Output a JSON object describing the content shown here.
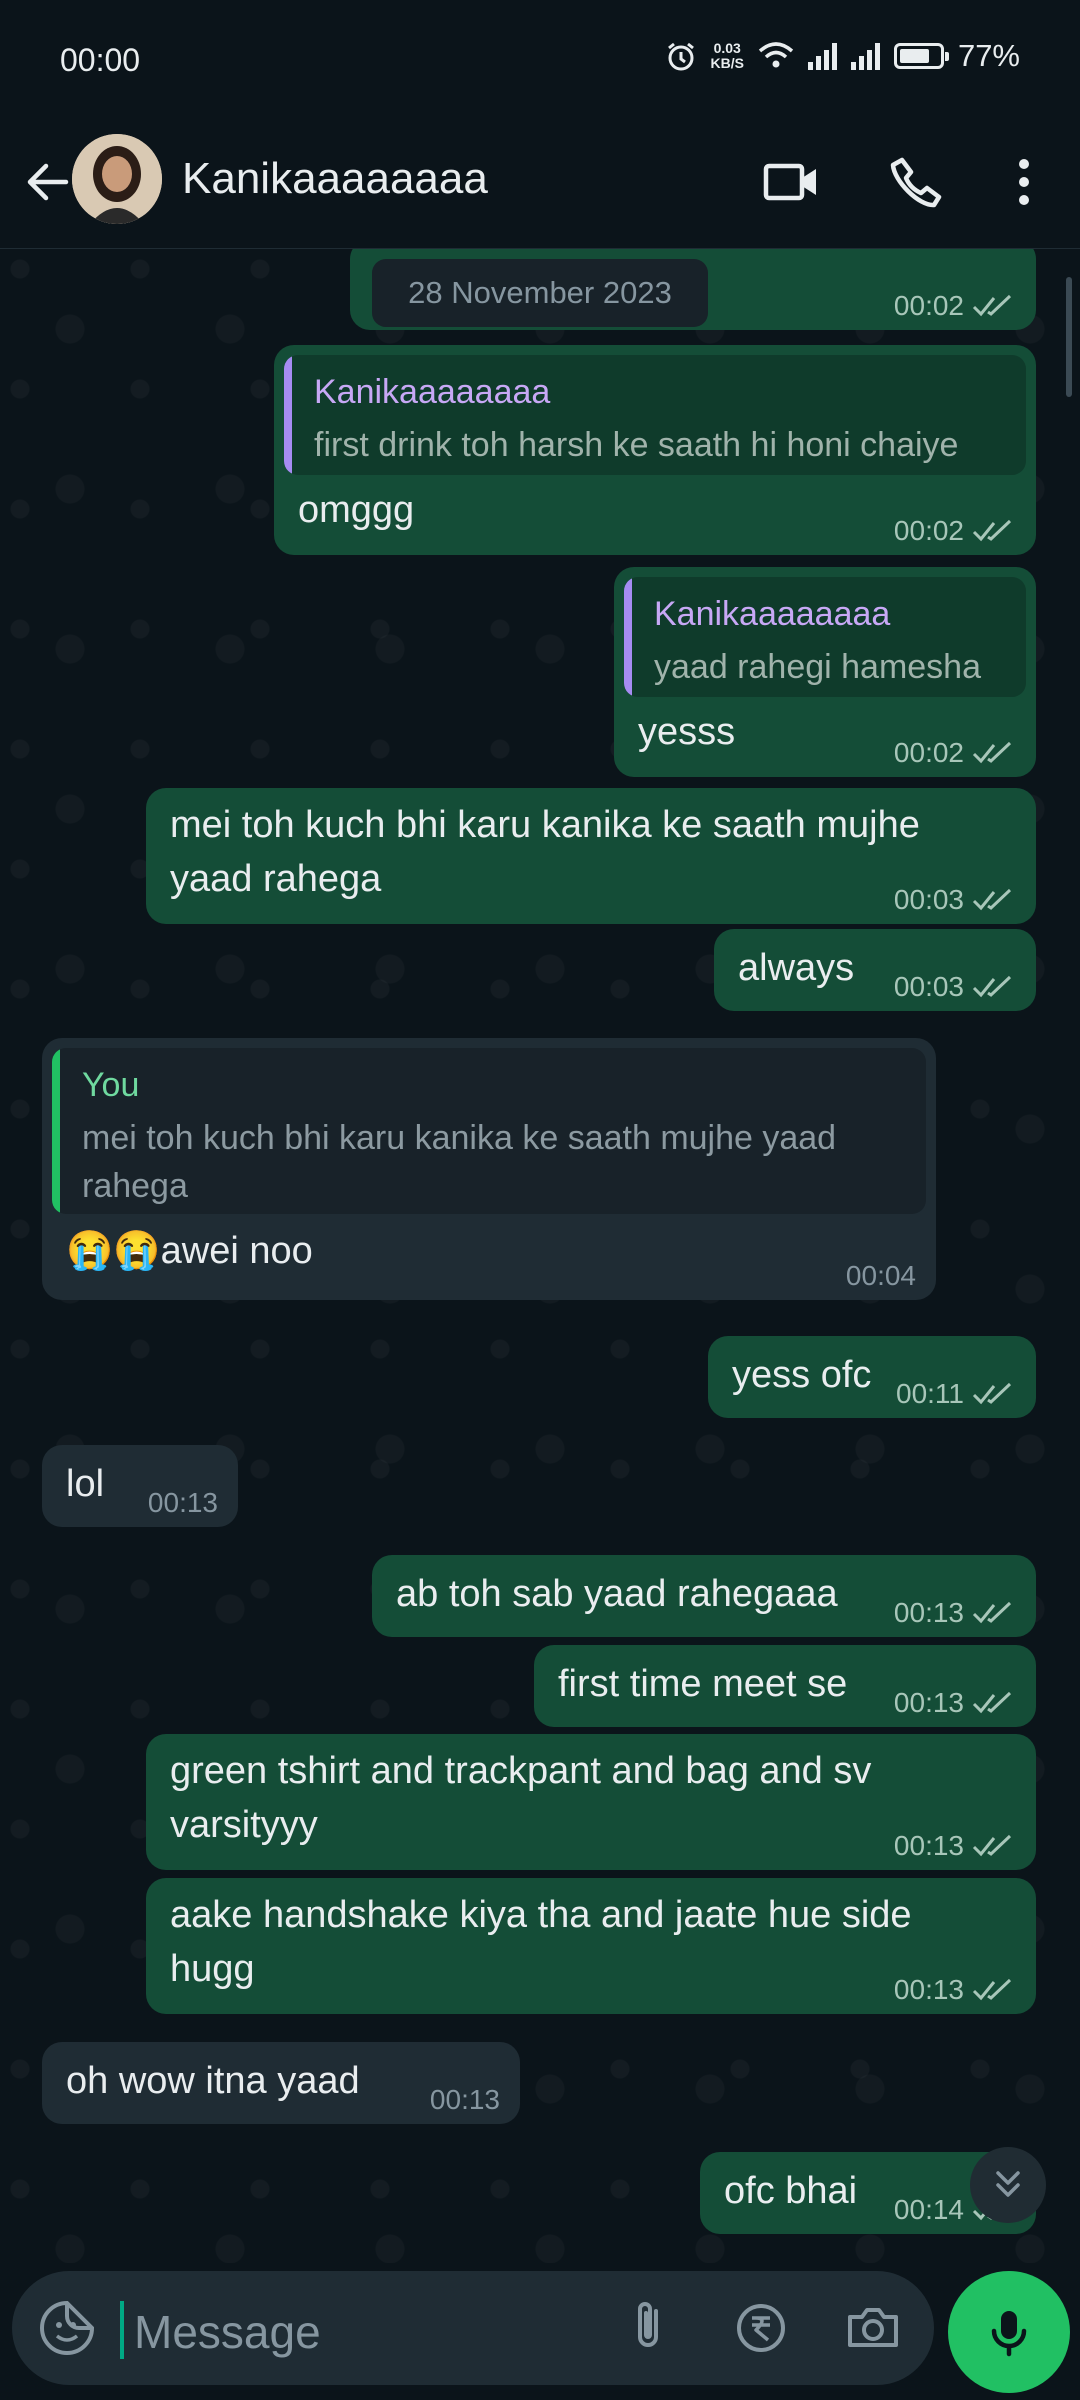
{
  "status": {
    "time": "00:00",
    "speed_value": "0.03",
    "speed_unit": "KB/S",
    "battery": "77%",
    "battery_level": 0.77
  },
  "header": {
    "contact_name": "Kanikaaaaaaaa",
    "icons": [
      "back-arrow-icon",
      "avatar",
      "video-call-icon",
      "voice-call-icon",
      "more-options-icon"
    ]
  },
  "chat": {
    "date_label": "28 November 2023",
    "first_time": "00:02",
    "messages": [
      {
        "dir": "out",
        "reply_name": "Kanikaaaaaaaa",
        "reply_text": "first drink toh harsh ke saath hi honi chaiye",
        "text": "omggg",
        "time": "00:02"
      },
      {
        "dir": "out",
        "reply_name": "Kanikaaaaaaaa",
        "reply_text": "yaad rahegi hamesha",
        "text": "yesss",
        "time": "00:02"
      },
      {
        "dir": "out",
        "text_line1": "mei toh kuch bhi karu kanika ke saath mujhe",
        "text_line2": "yaad rahega",
        "time": "00:03"
      },
      {
        "dir": "out",
        "text": "always",
        "time": "00:03"
      },
      {
        "dir": "in",
        "reply_name": "You",
        "reply_line1": "mei toh kuch bhi karu kanika ke saath mujhe yaad",
        "reply_line2": "rahega",
        "text": "😭😭awei noo",
        "time": "00:04"
      },
      {
        "dir": "out",
        "text": "yess ofc",
        "time": "00:11"
      },
      {
        "dir": "in",
        "text": "lol",
        "time": "00:13"
      },
      {
        "dir": "out",
        "text": "ab toh sab yaad rahegaaa",
        "time": "00:13"
      },
      {
        "dir": "out",
        "text": "first time meet se",
        "time": "00:13"
      },
      {
        "dir": "out",
        "text_line1": "green tshirt and trackpant and bag and sv",
        "text_line2": "varsityyy",
        "time": "00:13"
      },
      {
        "dir": "out",
        "text_line1": "aake handshake kiya tha and jaate hue side",
        "text_line2": "hugg",
        "time": "00:13"
      },
      {
        "dir": "in",
        "text": "oh wow itna yaad",
        "time": "00:13"
      },
      {
        "dir": "out",
        "text": "ofc bhai",
        "time": "00:14"
      }
    ]
  },
  "input": {
    "placeholder": "Message",
    "icons": [
      "sticker-icon",
      "attach-icon",
      "rupee-payment-icon",
      "camera-icon",
      "mic-icon"
    ]
  },
  "colors": {
    "outgoing_bubble": "#144d37",
    "incoming_bubble": "#1f2c34",
    "background": "#0b141a",
    "accent_green": "#21c063",
    "reply_name_purple": "#c7a8f5",
    "reply_name_green": "#6fd99f"
  }
}
